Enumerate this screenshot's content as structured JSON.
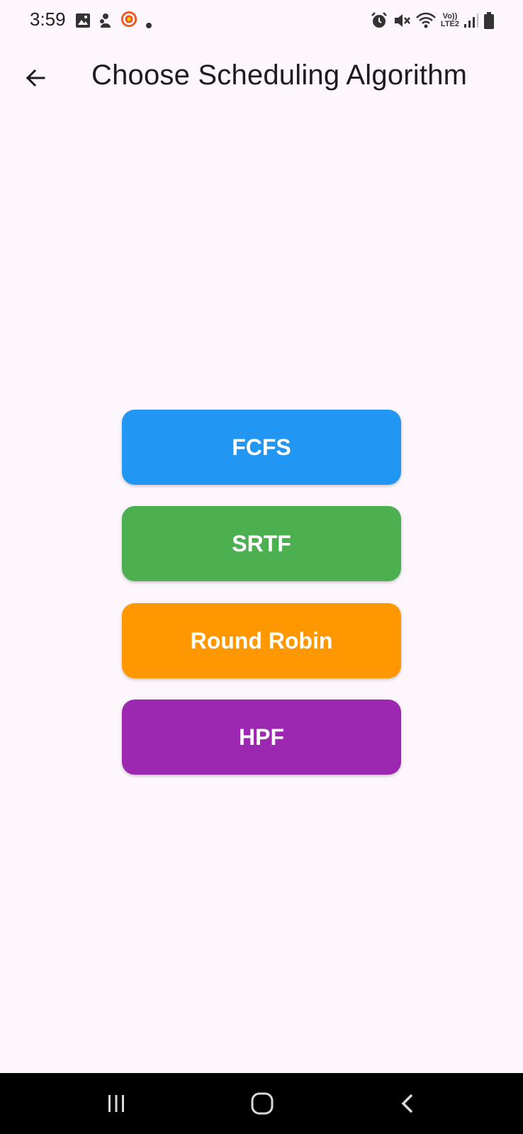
{
  "status_bar": {
    "time": "3:59",
    "network_label_top": "Vo))",
    "network_label_bottom": "LTE2"
  },
  "app_bar": {
    "title": "Choose Scheduling Algorithm"
  },
  "algorithms": [
    {
      "label": "FCFS",
      "color": "#2196f3"
    },
    {
      "label": "SRTF",
      "color": "#4caf50"
    },
    {
      "label": "Round Robin",
      "color": "#ff9800"
    },
    {
      "label": "HPF",
      "color": "#9c27b0"
    }
  ],
  "icons": {
    "back": "arrow-left-icon",
    "gallery": "image-icon",
    "app_notification": "app-icon",
    "alarm": "alarm-icon",
    "mute": "mute-icon",
    "wifi": "wifi-icon",
    "signal": "signal-icon",
    "battery": "battery-icon",
    "recent_apps": "recent-apps-icon",
    "home": "home-icon",
    "nav_back": "chevron-left-icon"
  }
}
